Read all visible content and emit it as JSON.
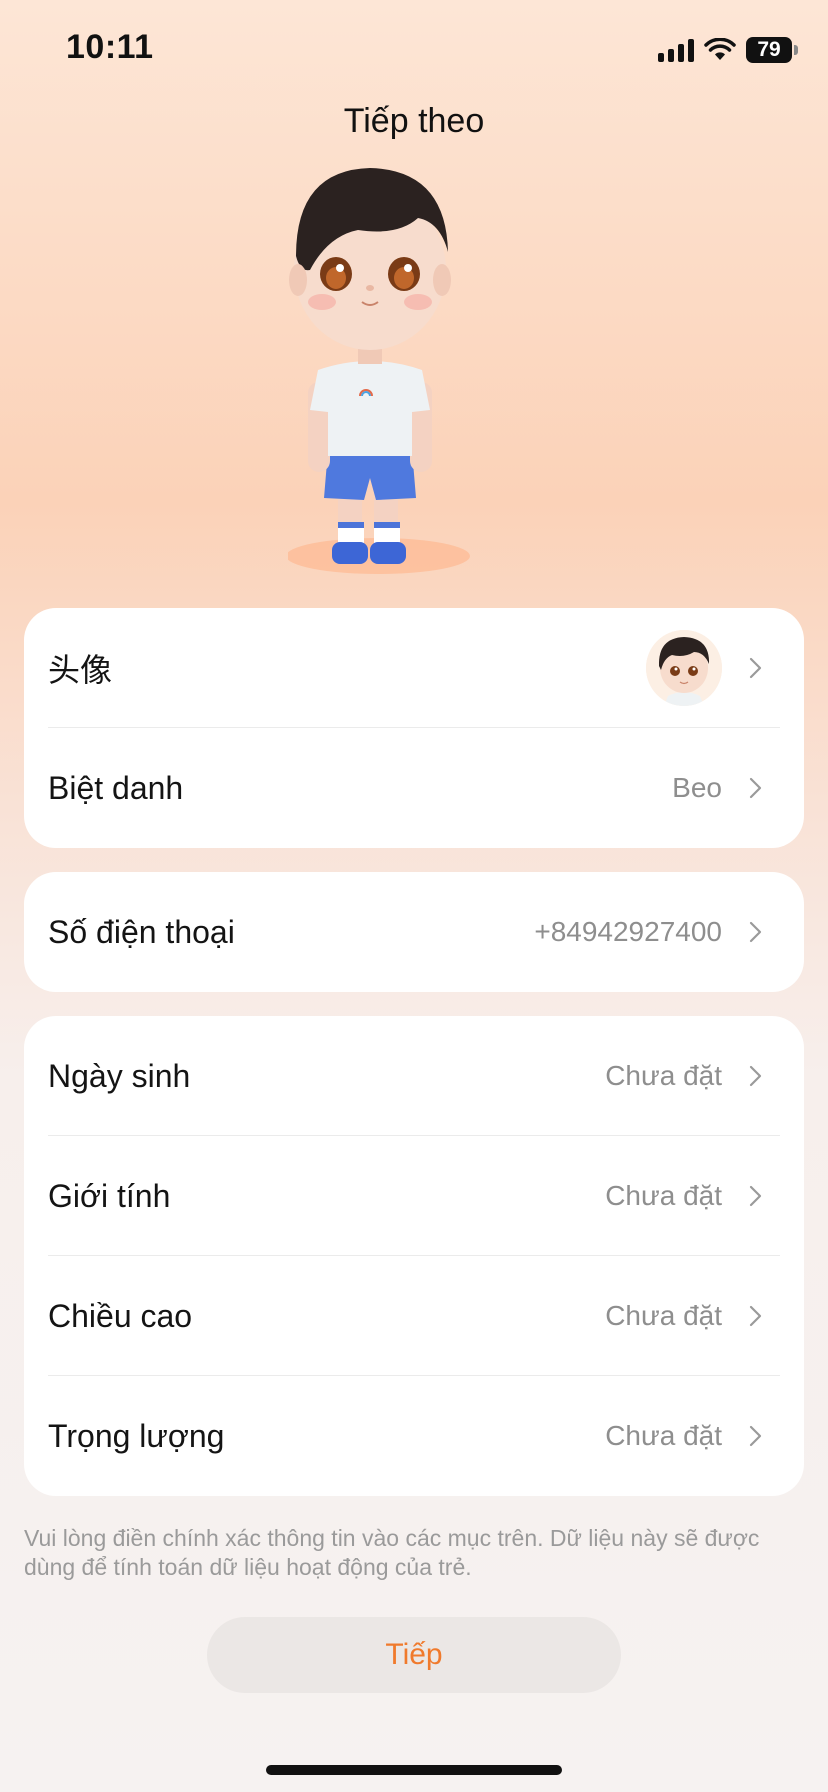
{
  "status_bar": {
    "time": "10:11",
    "battery": "79",
    "icons": [
      "signal-icon",
      "wifi-icon",
      "battery-icon"
    ]
  },
  "header": {
    "title": "Tiếp theo"
  },
  "section1": {
    "avatar_label": "头像",
    "nickname_label": "Biệt danh",
    "nickname_value": "Beo"
  },
  "section2": {
    "phone_label": "Số điện thoại",
    "phone_value": "+84942927400"
  },
  "section3": {
    "items": [
      {
        "label": "Ngày sinh",
        "value": "Chưa đặt"
      },
      {
        "label": "Giới tính",
        "value": "Chưa đặt"
      },
      {
        "label": "Chiều cao",
        "value": "Chưa đặt"
      },
      {
        "label": "Trọng lượng",
        "value": "Chưa đặt"
      }
    ]
  },
  "note": "Vui lòng điền chính xác thông tin vào các mục trên. Dữ liệu này sẽ được dùng để tính toán dữ liệu hoạt động của trẻ.",
  "next_button": {
    "label": "Tiếp"
  },
  "colors": {
    "accent": "#f07a2c",
    "background_top": "#fde6d6",
    "background_bottom": "#f6f2f1"
  }
}
